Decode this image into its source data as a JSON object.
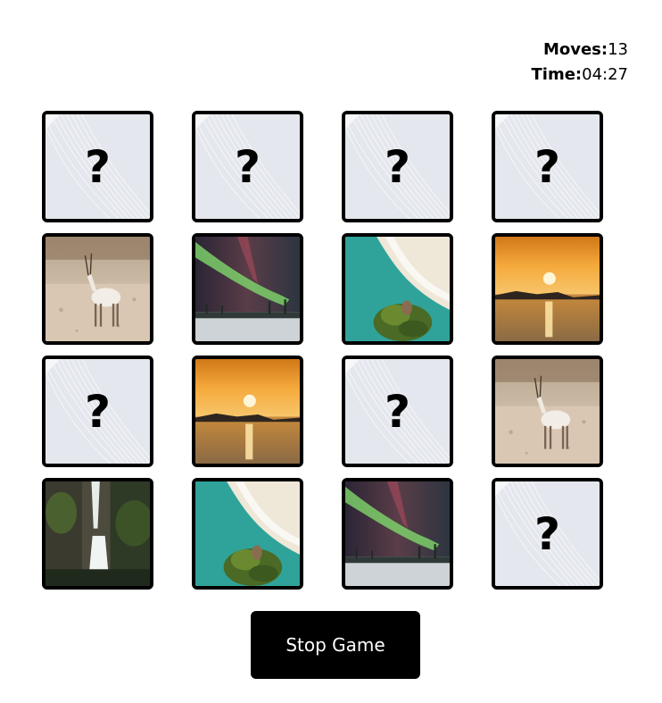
{
  "stats": {
    "moves_label": "Moves:",
    "moves_value": "13",
    "time_label": "Time:",
    "time_value": "04:27"
  },
  "cards": [
    {
      "state": "hidden",
      "label": "?"
    },
    {
      "state": "hidden",
      "label": "?"
    },
    {
      "state": "hidden",
      "label": "?"
    },
    {
      "state": "hidden",
      "label": "?"
    },
    {
      "state": "revealed",
      "image": "gazelle"
    },
    {
      "state": "revealed",
      "image": "aurora"
    },
    {
      "state": "revealed",
      "image": "beach-island"
    },
    {
      "state": "revealed",
      "image": "sunset"
    },
    {
      "state": "hidden",
      "label": "?"
    },
    {
      "state": "revealed",
      "image": "sunset"
    },
    {
      "state": "hidden",
      "label": "?"
    },
    {
      "state": "revealed",
      "image": "gazelle"
    },
    {
      "state": "revealed",
      "image": "waterfall"
    },
    {
      "state": "revealed",
      "image": "beach-island"
    },
    {
      "state": "revealed",
      "image": "aurora"
    },
    {
      "state": "hidden",
      "label": "?"
    }
  ],
  "stop_button_label": "Stop Game"
}
